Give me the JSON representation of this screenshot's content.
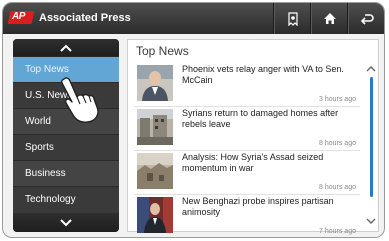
{
  "header": {
    "logo_text": "AP",
    "app_title": "Associated Press",
    "icons": [
      "sections-icon",
      "home-icon",
      "back-icon"
    ]
  },
  "sidebar": {
    "items": [
      {
        "label": "Top News",
        "active": true
      },
      {
        "label": "U.S. News",
        "active": false
      },
      {
        "label": "World",
        "active": false
      },
      {
        "label": "Sports",
        "active": false
      },
      {
        "label": "Business",
        "active": false
      },
      {
        "label": "Technology",
        "active": false
      }
    ]
  },
  "main": {
    "section_title": "Top News",
    "stories": [
      {
        "headline": "Phoenix vets relay anger with VA to Sen. McCain",
        "time": "3 hours ago"
      },
      {
        "headline": "Syrians return to damaged homes after rebels leave",
        "time": "8 hours ago"
      },
      {
        "headline": "Analysis: How Syria's Assad seized momentum in war",
        "time": "8 hours ago"
      },
      {
        "headline": "New Benghazi probe inspires partisan animosity",
        "time": "7 hours ago"
      }
    ]
  },
  "colors": {
    "header_bg": "#3a3a3a",
    "sidebar_bg": "#3a3a3a",
    "active_item": "#62a6d6",
    "brand_red": "#d81e1e",
    "scrollbar": "#2a78c8"
  }
}
